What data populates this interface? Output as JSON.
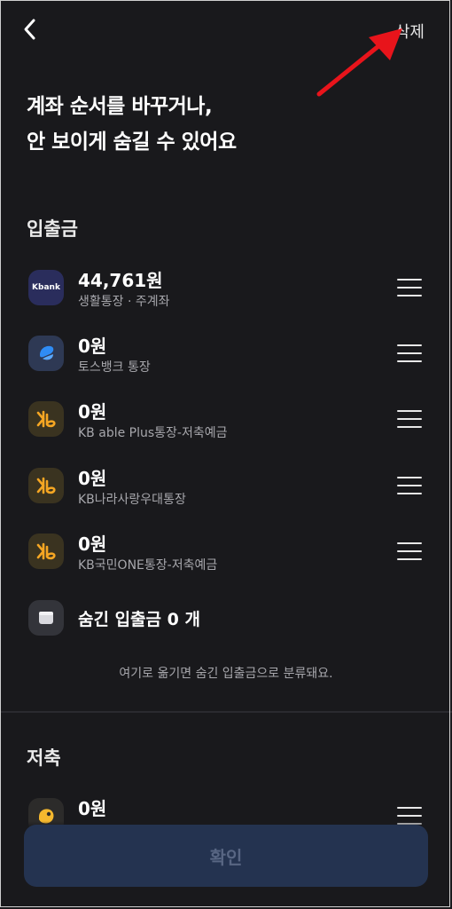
{
  "header": {
    "delete_label": "삭제"
  },
  "headline": {
    "line1": "계좌 순서를 바꾸거나,",
    "line2": "안 보이게 숨길 수 있어요"
  },
  "sections": {
    "checking": {
      "title": "입출금",
      "accounts": [
        {
          "amount": "44,761원",
          "name": "생활통장 · 주계좌",
          "icon": "kbank-logo",
          "icon_text": "Kbank"
        },
        {
          "amount": "0원",
          "name": "토스뱅크 통장",
          "icon": "toss-logo"
        },
        {
          "amount": "0원",
          "name": "KB able Plus통장-저축예금",
          "icon": "kb-logo"
        },
        {
          "amount": "0원",
          "name": "KB나라사랑우대통장",
          "icon": "kb-logo"
        },
        {
          "amount": "0원",
          "name": "KB국민ONE통장-저축예금",
          "icon": "kb-logo"
        }
      ],
      "hidden": {
        "label": "숨긴 입출금 0 개",
        "icon": "folder-icon"
      },
      "hint": "여기로 옮기면 숨긴 입출금으로 분류돼요."
    },
    "savings": {
      "title": "저축",
      "accounts": [
        {
          "amount": "0원",
          "icon": "savings-logo"
        }
      ]
    }
  },
  "footer": {
    "confirm_label": "확인"
  },
  "colors": {
    "background": "#19191c",
    "arrow": "#e8141b",
    "kb_yellow": "#f5a623",
    "toss_blue": "#2f8cf5",
    "confirm_bg": "#243350"
  }
}
